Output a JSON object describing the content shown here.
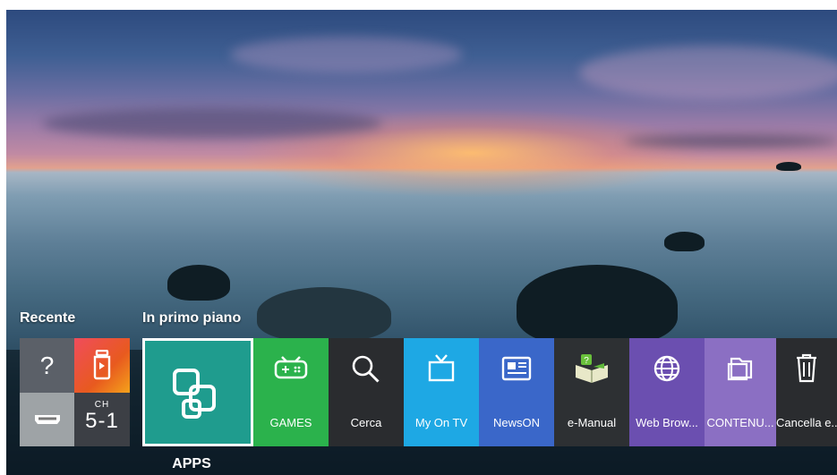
{
  "sections": {
    "recent_title": "Recente",
    "featured_title": "In primo piano"
  },
  "recent": {
    "help_symbol": "?",
    "channel_prefix": "CH",
    "channel_number": "5-1"
  },
  "featured": {
    "apps_label": "APPS"
  },
  "apps": [
    {
      "label": "GAMES",
      "icon": "gamepad-icon",
      "color": "#2bb24c"
    },
    {
      "label": "Cerca",
      "icon": "search-icon",
      "color": "#2a2c2f"
    },
    {
      "label": "My On TV",
      "icon": "tv-icon",
      "color": "#1ea8e4"
    },
    {
      "label": "NewsON",
      "icon": "news-icon",
      "color": "#3a67c9"
    },
    {
      "label": "e-Manual",
      "icon": "book-icon",
      "color": "#2d3033"
    },
    {
      "label": "Web Brow...",
      "icon": "globe-icon",
      "color": "#6b4fb0"
    },
    {
      "label": "CONTENU...",
      "icon": "folder-icon",
      "color": "#8b6fc3"
    },
    {
      "label": "Cancella e...",
      "icon": "trash-icon",
      "color": "#2a2c2f"
    }
  ],
  "colors": {
    "apps_tile": "#1f9c8e",
    "help_tile": "#5b6068",
    "recent_app_tile": "#e64b2f",
    "hdmi_tile": "#9ea3a6",
    "channel_tile": "#3c3f45",
    "focus_border": "#ffffff"
  }
}
